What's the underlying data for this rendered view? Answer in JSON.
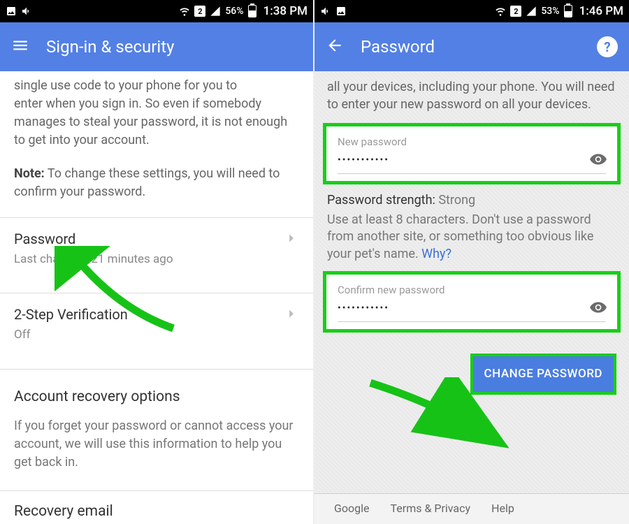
{
  "left": {
    "status": {
      "battery_pct": "56%",
      "clock": "1:38 PM",
      "sim": "2"
    },
    "appbar": {
      "title": "Sign-in & security"
    },
    "intro_fragment": "enter when you sign in. So even if somebody manages to steal your password, it is not enough to get into your account.",
    "note_label": "Note:",
    "note_text": " To change these settings, you will need to confirm your password.",
    "password_row": {
      "label": "Password",
      "sub": "Last changed: 21 minutes ago"
    },
    "twostep_row": {
      "label": "2-Step Verification",
      "sub": "Off"
    },
    "recovery": {
      "title": "Account recovery options",
      "desc": "If you forget your password or cannot access your account, we will use this information to help you get back in."
    },
    "cutoff_row": "Recovery email"
  },
  "right": {
    "status": {
      "battery_pct": "53%",
      "clock": "1:46 PM",
      "sim": "2"
    },
    "appbar": {
      "title": "Password",
      "help": "?"
    },
    "intro": "all your devices, including your phone. You will need to enter your new password on all your devices.",
    "field1": {
      "label": "New password",
      "value": "•••••••••••"
    },
    "strength_label": "Password strength:",
    "strength_value": "Strong",
    "hint": "Use at least 8 characters. Don't use a password from another site, or something too obvious like your pet's name. ",
    "hint_link": "Why?",
    "field2": {
      "label": "Confirm new password",
      "value": "•••••••••••"
    },
    "change_btn": "CHANGE PASSWORD",
    "footer": {
      "a": "Google",
      "b": "Terms & Privacy",
      "c": "Help"
    }
  }
}
